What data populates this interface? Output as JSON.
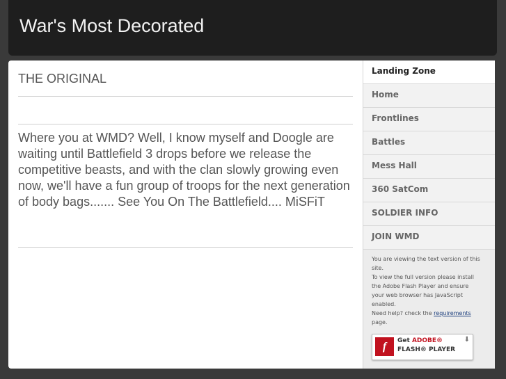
{
  "site": {
    "title": "War's Most Decorated"
  },
  "page": {
    "heading": "THE ORIGINAL",
    "body": "Where you at WMD? Well, I know myself and Doogle are waiting until Battlefield 3 drops before we release the competitive beasts, and with the clan slowly growing even now, we'll have a fun group of troops for the next generation of body bags....... See You On The Battlefield.... MiSFiT"
  },
  "sidebar": {
    "items": [
      {
        "label": "Landing Zone"
      },
      {
        "label": "Home"
      },
      {
        "label": "Frontlines"
      },
      {
        "label": "Battles"
      },
      {
        "label": "Mess Hall"
      },
      {
        "label": "360 SatCom"
      },
      {
        "label": "SOLDIER INFO"
      },
      {
        "label": "JOIN WMD"
      }
    ],
    "notice": {
      "line1": "You are viewing the text version of this site.",
      "line2": "To view the full version please install the Adobe Flash Player and ensure your web browser has JavaScript enabled.",
      "line3_prefix": "Need help? check the",
      "line3_link": "requirements",
      "line3_suffix": "page."
    },
    "flash_badge": {
      "get": "Get",
      "adobe": "ADOBE®",
      "product": "FLASH® PLAYER",
      "icon_glyph": "f",
      "arrow": "⬇"
    }
  },
  "colors": {
    "background": "#3a3a3a",
    "header": "#1e1e1e",
    "adobe_red": "#c1121f"
  }
}
